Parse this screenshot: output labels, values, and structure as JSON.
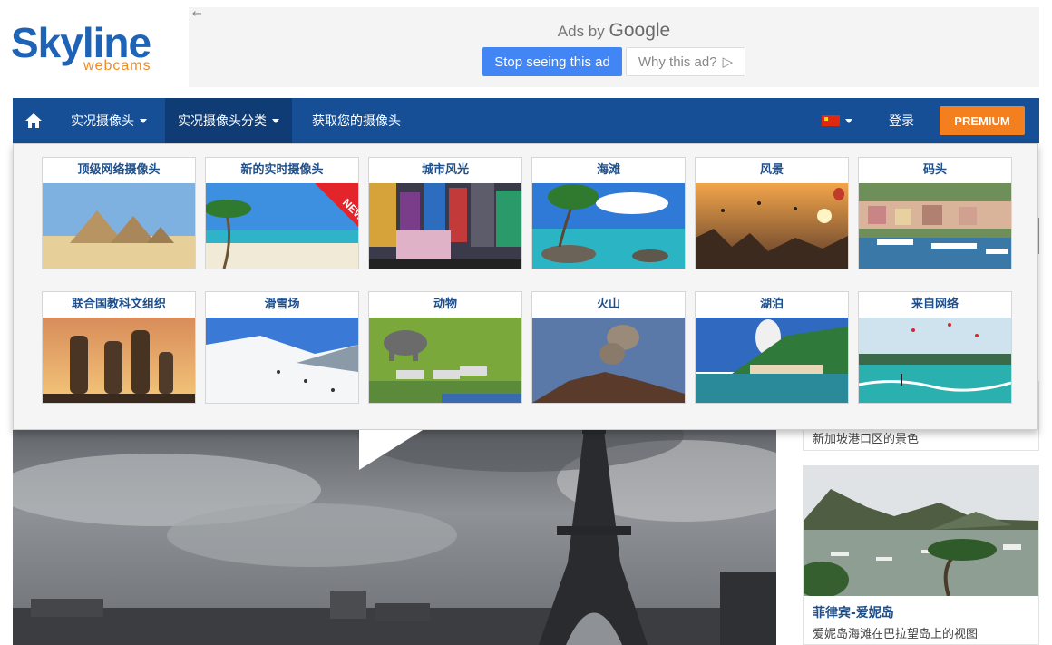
{
  "logo": {
    "main": "Skyline",
    "sub": "webcams"
  },
  "ad": {
    "back_glyph": "←",
    "ads_by": "Ads by",
    "google": "Google",
    "stop_label": "Stop seeing this ad",
    "why_label": "Why this ad?",
    "why_icon": "▷"
  },
  "nav": {
    "home_icon": "home-icon",
    "live_cams": "实况摄像头",
    "categories": "实况摄像头分类",
    "get_cam": "获取您的摄像头",
    "language_flag": "china-flag-icon",
    "login": "登录",
    "premium": "PREMIUM"
  },
  "categories": [
    {
      "label": "顶级网络摄像头",
      "thumb": "pyramids"
    },
    {
      "label": "新的实时摄像头",
      "thumb": "beach-new",
      "badge": "NEW"
    },
    {
      "label": "城市风光",
      "thumb": "city"
    },
    {
      "label": "海滩",
      "thumb": "beach"
    },
    {
      "label": "风景",
      "thumb": "landscape"
    },
    {
      "label": "码头",
      "thumb": "harbor"
    },
    {
      "label": "联合国教科文组织",
      "thumb": "moai"
    },
    {
      "label": "滑雪场",
      "thumb": "ski"
    },
    {
      "label": "动物",
      "thumb": "animals"
    },
    {
      "label": "火山",
      "thumb": "volcano"
    },
    {
      "label": "湖泊",
      "thumb": "lake"
    },
    {
      "label": "来自网络",
      "thumb": "kites"
    }
  ],
  "sidebar": {
    "card1_desc": "新加坡港口区的景色",
    "card2_title": "菲律宾-爱妮岛",
    "card2_desc": "爱妮岛海滩在巴拉望岛上的视图"
  },
  "colors": {
    "nav_blue": "#164f96",
    "nav_active": "#0f3c74",
    "premium_orange": "#f47f1f",
    "ad_blue": "#4285f4",
    "label_blue": "#1f4f8a"
  }
}
